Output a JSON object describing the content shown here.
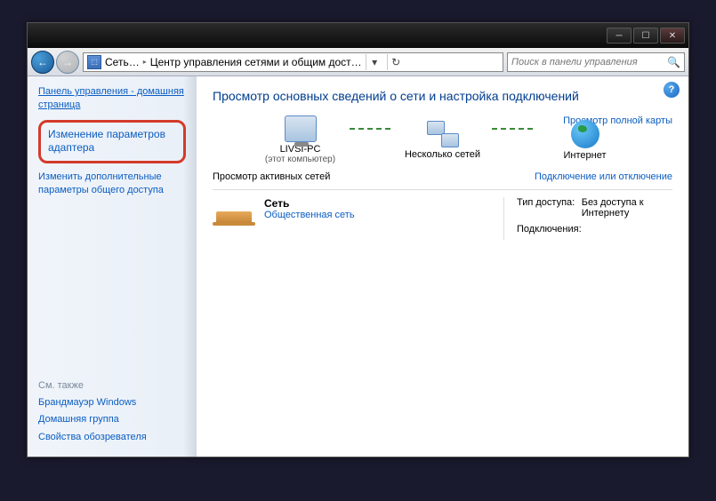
{
  "titlebar": {
    "min": "─",
    "max": "☐",
    "close": "✕"
  },
  "nav": {
    "arrow_back": "←",
    "arrow_fwd": "→",
    "crumb1": "Сеть…",
    "crumb2": "Центр управления сетями и общим дост…",
    "dropdown": "▾",
    "refresh": "↻",
    "search_placeholder": "Поиск в панели управления",
    "search_icon": "🔍"
  },
  "sidebar": {
    "home": "Панель управления - домашняя страница",
    "adapter": "Изменение параметров адаптера",
    "sharing": "Изменить дополнительные параметры общего доступа",
    "seealso_hdr": "См. также",
    "firewall": "Брандмауэр Windows",
    "homegroup": "Домашняя группа",
    "ieprops": "Свойства обозревателя"
  },
  "main": {
    "help": "?",
    "title": "Просмотр основных сведений о сети и настройка подключений",
    "fullmap": "Просмотр полной карты",
    "node_pc": "LIVSI-PC",
    "node_pc_sub": "(этот компьютер)",
    "node_multi": "Несколько сетей",
    "node_internet": "Интернет",
    "active_label": "Просмотр активных сетей",
    "connect_link": "Подключение или отключение",
    "net_name": "Сеть",
    "net_type": "Общественная сеть",
    "access_label": "Тип доступа:",
    "access_val": "Без доступа к Интернету",
    "conn_label": "Подключения:"
  }
}
